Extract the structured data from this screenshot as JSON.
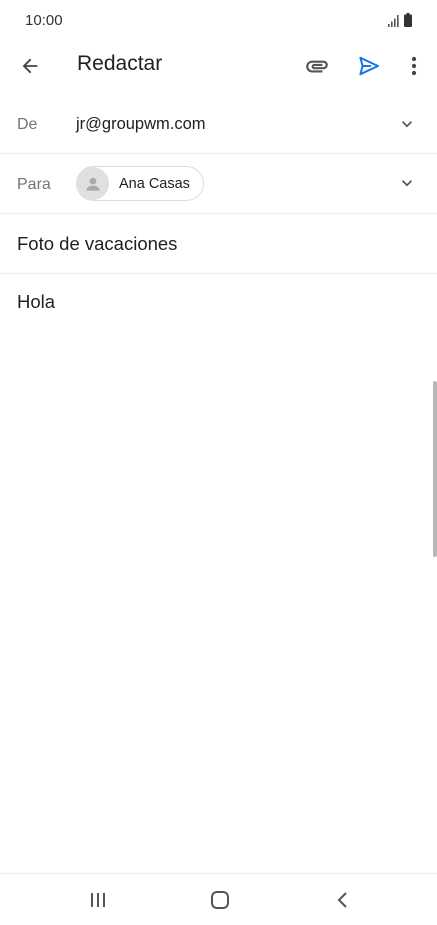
{
  "status_bar": {
    "time": "10:00",
    "icons": [
      "signal-icon",
      "battery-icon"
    ]
  },
  "app_bar": {
    "title": "Redactar",
    "icons": {
      "back": "arrow-back-icon",
      "attach": "paperclip-icon",
      "send": "send-icon",
      "more": "more-vert-icon"
    },
    "accent_color": "#1a73e8"
  },
  "compose": {
    "from": {
      "label": "De",
      "value": "jr@groupwm.com"
    },
    "to": {
      "label": "Para",
      "recipients": [
        {
          "name": "Ana Casas"
        }
      ]
    },
    "subject": {
      "value": "Foto de vacaciones"
    },
    "body": {
      "value": "Hola"
    }
  },
  "nav_bar": {
    "icons": [
      "recents-icon",
      "home-icon",
      "back-icon"
    ]
  }
}
